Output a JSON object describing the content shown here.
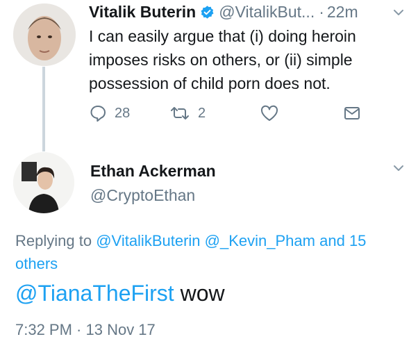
{
  "tweet1": {
    "author_name": "Vitalik Buterin",
    "handle": "@VitalikBut...",
    "separator": "·",
    "time": "22m",
    "text": "I can easily argue that (i) doing heroin imposes risks on others, or (ii) simple possession of child porn does not.",
    "reply_count": "28",
    "retweet_count": "2",
    "icons": [
      "verified-badge-icon",
      "chevron-down-icon",
      "reply-icon",
      "retweet-icon",
      "heart-icon",
      "direct-message-icon"
    ]
  },
  "tweet2": {
    "author_name": "Ethan Ackerman",
    "handle": "@CryptoEthan",
    "replying_prefix": "Replying to",
    "replying_user1": "@VitalikButerin",
    "replying_user2": "@_Kevin_Pham",
    "replying_and": "and",
    "replying_others": "15 others",
    "mention": "@TianaTheFirst",
    "text": " wow",
    "timestamp": "7:32 PM · 13 Nov 17"
  },
  "colors": {
    "accent": "#1da1f2",
    "secondary_text": "#657786",
    "primary_text": "#14171a",
    "thread_line": "#ccd6dd"
  }
}
